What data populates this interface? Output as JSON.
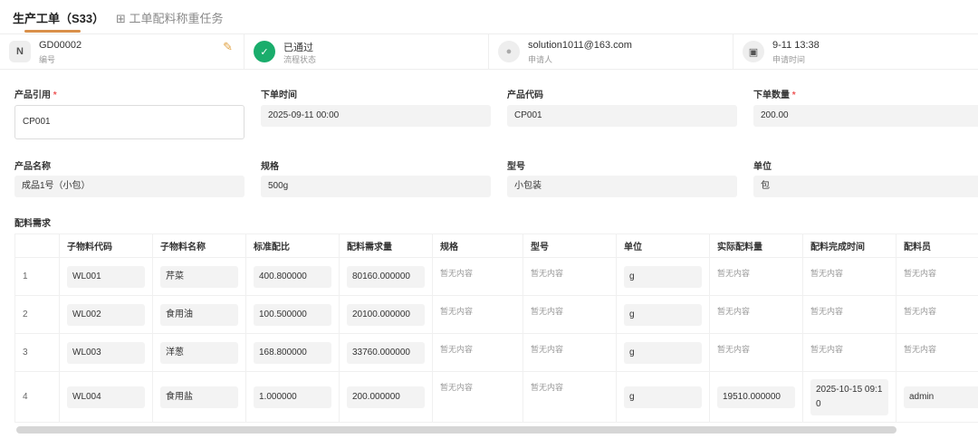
{
  "tabs": [
    "生产工单（S33）",
    "工单配料称重任务"
  ],
  "info": [
    {
      "value": "GD00002",
      "label": "编号",
      "icon": "n-icon"
    },
    {
      "value": "已通过",
      "label": "流程状态",
      "icon": "check-icon"
    },
    {
      "value": "solution1011@163.com",
      "label": "申请人",
      "icon": "user-icon"
    },
    {
      "value": "9-11 13:38",
      "label": "申请时间",
      "icon": "calendar-icon"
    }
  ],
  "form": [
    {
      "label": "产品引用",
      "required": "*",
      "value": "CP001"
    },
    {
      "label": "下单时间",
      "value": "2025-09-11 00:00"
    },
    {
      "label": "产品代码",
      "value": "CP001"
    },
    {
      "label": "下单数量",
      "required": "*",
      "value": "200.00"
    },
    {
      "label": "产品名称",
      "value": "成品1号（小包）"
    },
    {
      "label": "规格",
      "value": "500g"
    },
    {
      "label": "型号",
      "value": "小包装"
    },
    {
      "label": "单位",
      "value": "包"
    }
  ],
  "section_title": "配料需求",
  "table": {
    "headers": [
      "",
      "子物料代码",
      "子物料名称",
      "标准配比",
      "配料需求量",
      "规格",
      "型号",
      "单位",
      "实际配料量",
      "配料完成时间",
      "配料员"
    ],
    "empty": "暂无内容",
    "rows": [
      [
        "1",
        "WL001",
        "芹菜",
        "400.800000",
        "80160.000000",
        "",
        "",
        "g",
        "",
        "",
        ""
      ],
      [
        "2",
        "WL002",
        "食用油",
        "100.500000",
        "20100.000000",
        "",
        "",
        "g",
        "",
        "",
        ""
      ],
      [
        "3",
        "WL003",
        "洋葱",
        "168.800000",
        "33760.000000",
        "",
        "",
        "g",
        "",
        "",
        ""
      ],
      [
        "4",
        "WL004",
        "食用盐",
        "1.000000",
        "200.000000",
        "",
        "",
        "g",
        "19510.000000",
        "2025-10-15 09:10",
        "admin"
      ]
    ]
  }
}
